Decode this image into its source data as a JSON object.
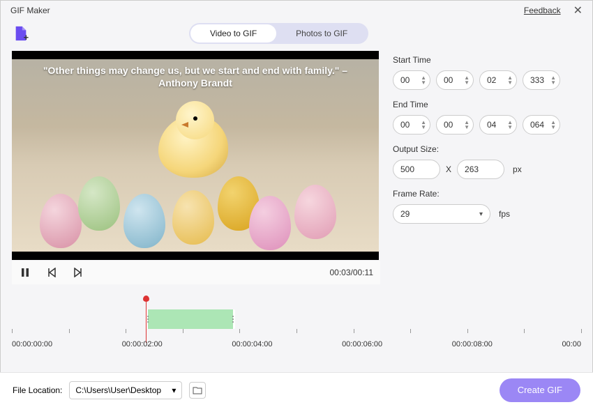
{
  "title": "GIF Maker",
  "feedback": "Feedback",
  "tabs": {
    "video": "Video to GIF",
    "photos": "Photos to GIF"
  },
  "quote": {
    "line": "\"Other things may change us, but we start and end with family.\" –",
    "author": "Anthony Brandt"
  },
  "timecode": "00:03/00:11",
  "start": {
    "label": "Start Time",
    "h": "00",
    "m": "00",
    "s": "02",
    "ms": "333"
  },
  "end": {
    "label": "End Time",
    "h": "00",
    "m": "00",
    "s": "04",
    "ms": "064"
  },
  "output": {
    "label": "Output Size:",
    "w": "500",
    "h": "263",
    "unit": "px"
  },
  "framerate": {
    "label": "Frame Rate:",
    "value": "29",
    "unit": "fps"
  },
  "ticks": [
    "00:00:00:00",
    "00:00:02:00",
    "00:00:04:00",
    "00:00:06:00",
    "00:00:08:00",
    "00:00"
  ],
  "file": {
    "label": "File Location:",
    "path": "C:\\Users\\User\\Desktop"
  },
  "create": "Create GIF"
}
